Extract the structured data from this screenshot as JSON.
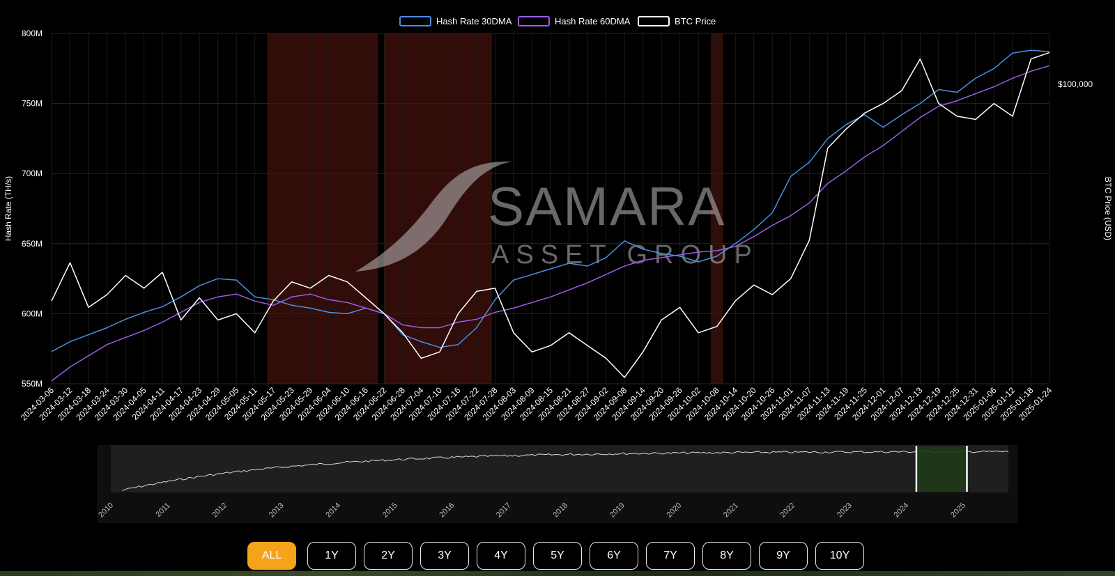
{
  "chart_data": {
    "type": "line",
    "legend": {
      "placement": "top-center",
      "entries": [
        {
          "name": "Hash Rate 30DMA",
          "color": "#4a90e2"
        },
        {
          "name": "Hash Rate 60DMA",
          "color": "#9b5de5"
        },
        {
          "name": "BTC Price",
          "color": "#ffffff"
        }
      ]
    },
    "y_left": {
      "label": "Hash Rate (TH/s)",
      "min": 550,
      "max": 800,
      "ticks": [
        "550M",
        "600M",
        "650M",
        "700M",
        "750M",
        "800M"
      ],
      "tick_values": [
        550,
        600,
        650,
        700,
        750,
        800
      ]
    },
    "y_right": {
      "label": "BTC Price (USD)",
      "ticks": [
        "$100,000"
      ],
      "tick_values": [
        100000
      ],
      "min": 53000,
      "max": 108000
    },
    "x_labels": [
      "2024-03-06",
      "2024-03-12",
      "2024-03-18",
      "2024-03-24",
      "2024-03-30",
      "2024-04-05",
      "2024-04-11",
      "2024-04-17",
      "2024-04-23",
      "2024-04-29",
      "2024-05-05",
      "2024-05-11",
      "2024-05-17",
      "2024-05-23",
      "2024-05-29",
      "2024-06-04",
      "2024-06-10",
      "2024-06-16",
      "2024-06-22",
      "2024-06-28",
      "2024-07-04",
      "2024-07-10",
      "2024-07-16",
      "2024-07-22",
      "2024-07-28",
      "2024-08-03",
      "2024-08-09",
      "2024-08-15",
      "2024-08-21",
      "2024-08-27",
      "2024-09-02",
      "2024-09-08",
      "2024-09-14",
      "2024-09-20",
      "2024-09-26",
      "2024-10-02",
      "2024-10-08",
      "2024-10-14",
      "2024-10-20",
      "2024-10-26",
      "2024-11-01",
      "2024-11-07",
      "2024-11-13",
      "2024-11-19",
      "2024-11-25",
      "2024-12-01",
      "2024-12-07",
      "2024-12-13",
      "2024-12-19",
      "2024-12-25",
      "2024-12-31",
      "2025-01-06",
      "2025-01-12",
      "2025-01-18",
      "2025-01-24"
    ],
    "grid": true,
    "shaded_ranges": [
      {
        "start": "2024-05-15",
        "end": "2024-06-20",
        "color": "#3a0e0a"
      },
      {
        "start": "2024-06-22",
        "end": "2024-07-27",
        "color": "#3a0e0a"
      },
      {
        "start": "2024-10-06",
        "end": "2024-10-10",
        "color": "#3a0e0a"
      }
    ],
    "series": [
      {
        "name": "Hash Rate 30DMA",
        "color": "#4a90e2",
        "axis": "left",
        "x": [
          "2024-03-06",
          "2024-03-12",
          "2024-03-18",
          "2024-03-24",
          "2024-03-30",
          "2024-04-05",
          "2024-04-11",
          "2024-04-17",
          "2024-04-23",
          "2024-04-29",
          "2024-05-05",
          "2024-05-11",
          "2024-05-17",
          "2024-05-23",
          "2024-05-29",
          "2024-06-04",
          "2024-06-10",
          "2024-06-16",
          "2024-06-22",
          "2024-06-28",
          "2024-07-04",
          "2024-07-10",
          "2024-07-16",
          "2024-07-22",
          "2024-07-28",
          "2024-08-03",
          "2024-08-09",
          "2024-08-15",
          "2024-08-21",
          "2024-08-27",
          "2024-09-02",
          "2024-09-08",
          "2024-09-14",
          "2024-09-20",
          "2024-09-26",
          "2024-10-02",
          "2024-10-08",
          "2024-10-14",
          "2024-10-20",
          "2024-10-26",
          "2024-11-01",
          "2024-11-07",
          "2024-11-13",
          "2024-11-19",
          "2024-11-25",
          "2024-12-01",
          "2024-12-07",
          "2024-12-13",
          "2024-12-19",
          "2024-12-25",
          "2024-12-31",
          "2025-01-06",
          "2025-01-12",
          "2025-01-18",
          "2025-01-24"
        ],
        "values": [
          573,
          580,
          585,
          590,
          596,
          601,
          605,
          612,
          620,
          625,
          624,
          612,
          610,
          606,
          604,
          601,
          600,
          604,
          600,
          585,
          580,
          576,
          578,
          590,
          610,
          624,
          628,
          632,
          636,
          634,
          640,
          652,
          646,
          643,
          641,
          637,
          641,
          650,
          660,
          672,
          698,
          708,
          725,
          735,
          742,
          733,
          742,
          750,
          760,
          758,
          768,
          775,
          786,
          788,
          787
        ]
      },
      {
        "name": "Hash Rate 60DMA",
        "color": "#9b5de5",
        "axis": "left",
        "x": [
          "2024-03-06",
          "2024-03-12",
          "2024-03-18",
          "2024-03-24",
          "2024-03-30",
          "2024-04-05",
          "2024-04-11",
          "2024-04-17",
          "2024-04-23",
          "2024-04-29",
          "2024-05-05",
          "2024-05-11",
          "2024-05-17",
          "2024-05-23",
          "2024-05-29",
          "2024-06-04",
          "2024-06-10",
          "2024-06-16",
          "2024-06-22",
          "2024-06-28",
          "2024-07-04",
          "2024-07-10",
          "2024-07-16",
          "2024-07-22",
          "2024-07-28",
          "2024-08-03",
          "2024-08-09",
          "2024-08-15",
          "2024-08-21",
          "2024-08-27",
          "2024-09-02",
          "2024-09-08",
          "2024-09-14",
          "2024-09-20",
          "2024-09-26",
          "2024-10-02",
          "2024-10-08",
          "2024-10-14",
          "2024-10-20",
          "2024-10-26",
          "2024-11-01",
          "2024-11-07",
          "2024-11-13",
          "2024-11-19",
          "2024-11-25",
          "2024-12-01",
          "2024-12-07",
          "2024-12-13",
          "2024-12-19",
          "2024-12-25",
          "2024-12-31",
          "2025-01-06",
          "2025-01-12",
          "2025-01-18",
          "2025-01-24"
        ],
        "values": [
          552,
          562,
          570,
          578,
          583,
          588,
          594,
          601,
          608,
          612,
          614,
          609,
          606,
          612,
          614,
          610,
          608,
          604,
          600,
          592,
          590,
          590,
          594,
          596,
          601,
          604,
          608,
          612,
          617,
          622,
          628,
          634,
          638,
          640,
          642,
          644,
          645,
          648,
          655,
          663,
          670,
          679,
          693,
          702,
          712,
          720,
          730,
          740,
          748,
          752,
          757,
          762,
          768,
          773,
          777
        ]
      },
      {
        "name": "BTC Price",
        "color": "#ffffff",
        "axis": "right",
        "x": [
          "2024-03-06",
          "2024-03-12",
          "2024-03-18",
          "2024-03-24",
          "2024-03-30",
          "2024-04-05",
          "2024-04-11",
          "2024-04-17",
          "2024-04-23",
          "2024-04-29",
          "2024-05-05",
          "2024-05-11",
          "2024-05-17",
          "2024-05-23",
          "2024-05-29",
          "2024-06-04",
          "2024-06-10",
          "2024-06-16",
          "2024-06-22",
          "2024-06-28",
          "2024-07-04",
          "2024-07-10",
          "2024-07-16",
          "2024-07-22",
          "2024-07-28",
          "2024-08-03",
          "2024-08-09",
          "2024-08-15",
          "2024-08-21",
          "2024-08-27",
          "2024-09-02",
          "2024-09-08",
          "2024-09-14",
          "2024-09-20",
          "2024-09-26",
          "2024-10-02",
          "2024-10-08",
          "2024-10-14",
          "2024-10-20",
          "2024-10-26",
          "2024-11-01",
          "2024-11-07",
          "2024-11-13",
          "2024-11-19",
          "2024-11-25",
          "2024-12-01",
          "2024-12-07",
          "2024-12-13",
          "2024-12-19",
          "2024-12-25",
          "2024-12-31",
          "2025-01-06",
          "2025-01-12",
          "2025-01-18",
          "2025-01-24"
        ],
        "values": [
          66000,
          72000,
          65000,
          67000,
          70000,
          68000,
          70500,
          63000,
          66500,
          63000,
          64000,
          61000,
          66000,
          69000,
          68000,
          70000,
          69000,
          66500,
          64000,
          61000,
          57000,
          58000,
          64000,
          67500,
          68000,
          61000,
          58000,
          59000,
          61000,
          59000,
          57000,
          54000,
          58000,
          63000,
          65000,
          61000,
          62000,
          66000,
          68500,
          67000,
          69500,
          75500,
          90000,
          93000,
          95500,
          97000,
          99000,
          104000,
          97000,
          95000,
          94500,
          97000,
          95000,
          104000,
          105000
        ]
      }
    ],
    "navigator": {
      "year_labels": [
        "2010",
        "2011",
        "2012",
        "2013",
        "2014",
        "2015",
        "2016",
        "2017",
        "2018",
        "2019",
        "2020",
        "2021",
        "2022",
        "2023",
        "2024",
        "2025"
      ],
      "selection": {
        "start": "2024-03-06",
        "end": "2025-01-24"
      }
    }
  },
  "watermark": {
    "line1": "SAMARA",
    "line2": "ASSET GROUP"
  },
  "range_buttons": {
    "active": "ALL",
    "labels": [
      "ALL",
      "1Y",
      "2Y",
      "3Y",
      "4Y",
      "5Y",
      "6Y",
      "7Y",
      "8Y",
      "9Y",
      "10Y"
    ]
  }
}
